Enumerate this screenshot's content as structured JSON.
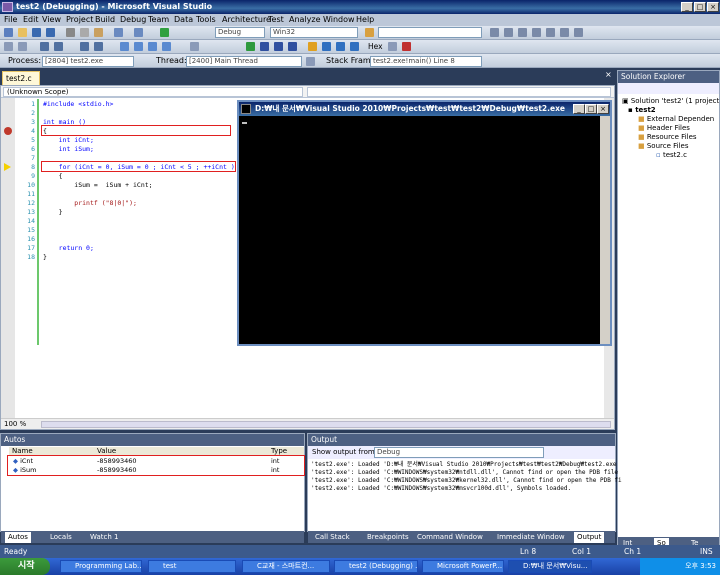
{
  "window": {
    "title": "test2 (Debugging) - Microsoft Visual Studio"
  },
  "menu": [
    "File",
    "Edit",
    "View",
    "Project",
    "Build",
    "Debug",
    "Team",
    "Data",
    "Tools",
    "Architecture",
    "Test",
    "Analyze",
    "Window",
    "Help"
  ],
  "toolbar": {
    "config": "Debug",
    "platform": "Win32",
    "hex_label": "Hex"
  },
  "debugbar": {
    "process_label": "Process:",
    "process": "[2804] test2.exe",
    "thread_label": "Thread:",
    "thread": "[2400] Main Thread",
    "stack_label": "Stack Frame:",
    "stack": "test2.exe!main()  Line 8"
  },
  "editor": {
    "tab": "test2.c",
    "scope": "(Unknown Scope)",
    "zoom": "100 %",
    "lines": [
      {
        "n": "1",
        "text": "#include <stdio.h>"
      },
      {
        "n": "2",
        "text": ""
      },
      {
        "n": "3",
        "text": "int main ()"
      },
      {
        "n": "4",
        "text": "{"
      },
      {
        "n": "5",
        "text": "    int iCnt;"
      },
      {
        "n": "6",
        "text": "    int iSum;"
      },
      {
        "n": "7",
        "text": ""
      },
      {
        "n": "8",
        "text": "    for (iCnt = 0, iSum = 0 ; iCnt < 5 ; ++iCnt )"
      },
      {
        "n": "9",
        "text": "    {"
      },
      {
        "n": "10",
        "text": "        iSum =  iSum + iCnt;"
      },
      {
        "n": "11",
        "text": ""
      },
      {
        "n": "12",
        "text": "        printf (\"8|0|\");"
      },
      {
        "n": "13",
        "text": "    }"
      },
      {
        "n": "14",
        "text": ""
      },
      {
        "n": "15",
        "text": ""
      },
      {
        "n": "16",
        "text": ""
      },
      {
        "n": "17",
        "text": "    return 0;"
      },
      {
        "n": "18",
        "text": "}"
      }
    ]
  },
  "console": {
    "title": "D:₩내 문서₩Visual Studio 2010₩Projects₩test₩test2₩Debug₩test2.exe"
  },
  "solution": {
    "header": "Solution Explorer",
    "items": [
      "Solution 'test2' (1 project",
      "test2",
      "External Dependen",
      "Header Files",
      "Resource Files",
      "Source Files",
      "test2.c"
    ]
  },
  "autos": {
    "header": "Autos",
    "columns": [
      "Name",
      "Value",
      "Type"
    ],
    "rows": [
      {
        "name": "iCnt",
        "value": "-858993460",
        "type": "int"
      },
      {
        "name": "iSum",
        "value": "-858993460",
        "type": "int"
      }
    ],
    "tabs": [
      "Autos",
      "Locals",
      "Watch 1"
    ]
  },
  "output": {
    "header": "Output",
    "show_label": "Show output from:",
    "source": "Debug",
    "lines": [
      "'test2.exe': Loaded 'D:₩내 문서₩Visual Studio 2010₩Projects₩test₩test2₩Debug₩test2.exe",
      "'test2.exe': Loaded 'C:₩WINDOWS₩system32₩ntdll.dll', Cannot find or open the PDB file",
      "'test2.exe': Loaded 'C:₩WINDOWS₩system32₩kernel32.dll', Cannot find or open the PDB fi",
      "'test2.exe': Loaded 'C:₩WINDOWS₩system32₩msvcr100d.dll', Symbols loaded."
    ],
    "tabs": [
      "Call Stack",
      "Breakpoints",
      "Command Window",
      "Immediate Window",
      "Output"
    ]
  },
  "sol_tabs": [
    "Int",
    "So",
    "Te"
  ],
  "status": {
    "left": "Ready",
    "ln": "Ln 8",
    "col": "Col 1",
    "ch": "Ch 1",
    "ins": "INS"
  },
  "taskbar": {
    "start": "시작",
    "tasks": [
      "Programming Lab...",
      "test",
      "C교재 - 스마트컨...",
      "test2 (Debugging) ...",
      "Microsoft PowerP...",
      "D:₩내 문서₩Visu..."
    ],
    "clock": "오후 3:53"
  },
  "colors": {
    "breakpoint": "#c0392b",
    "current_line": "#f5d000",
    "highlight_box": "#e02020"
  }
}
